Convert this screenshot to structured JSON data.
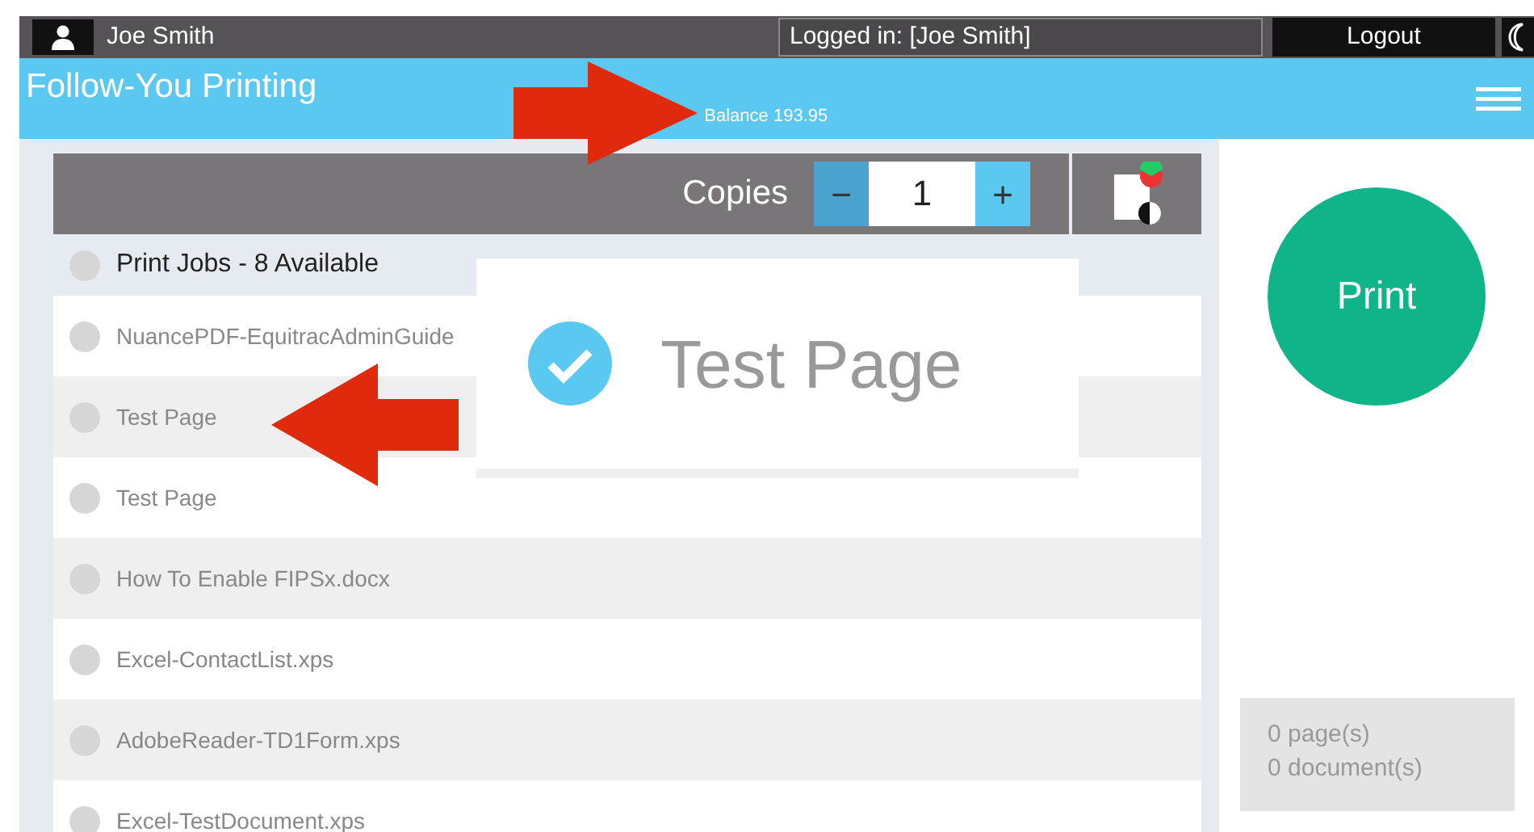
{
  "top_bar": {
    "user": "Joe Smith",
    "logged_in": "Logged in: [Joe Smith]",
    "logout": "Logout"
  },
  "header": {
    "title": "Follow-You Printing",
    "balance": "Balance 193.95"
  },
  "toolbar": {
    "copies_label": "Copies",
    "minus": "−",
    "copies": "1",
    "plus": "+"
  },
  "jobs": {
    "title": "Print Jobs - 8 Available",
    "title_selected": false,
    "rows": [
      {
        "name": "NuancePDF-EquitracAdminGuide",
        "selected": false
      },
      {
        "name": "Test Page",
        "selected": false
      },
      {
        "name": "Test Page",
        "selected": false
      },
      {
        "name": "How To Enable FIPSx.docx",
        "selected": false
      },
      {
        "name": "Excel-ContactList.xps",
        "selected": false
      },
      {
        "name": "AdobeReader-TD1Form.xps",
        "selected": false
      },
      {
        "name": "Excel-TestDocument.xps",
        "selected": false
      }
    ]
  },
  "print_button": "Print",
  "summary": {
    "pages": "0 page(s)",
    "documents": "0 document(s)"
  },
  "callout": {
    "label": "Test Page",
    "checked": true
  }
}
